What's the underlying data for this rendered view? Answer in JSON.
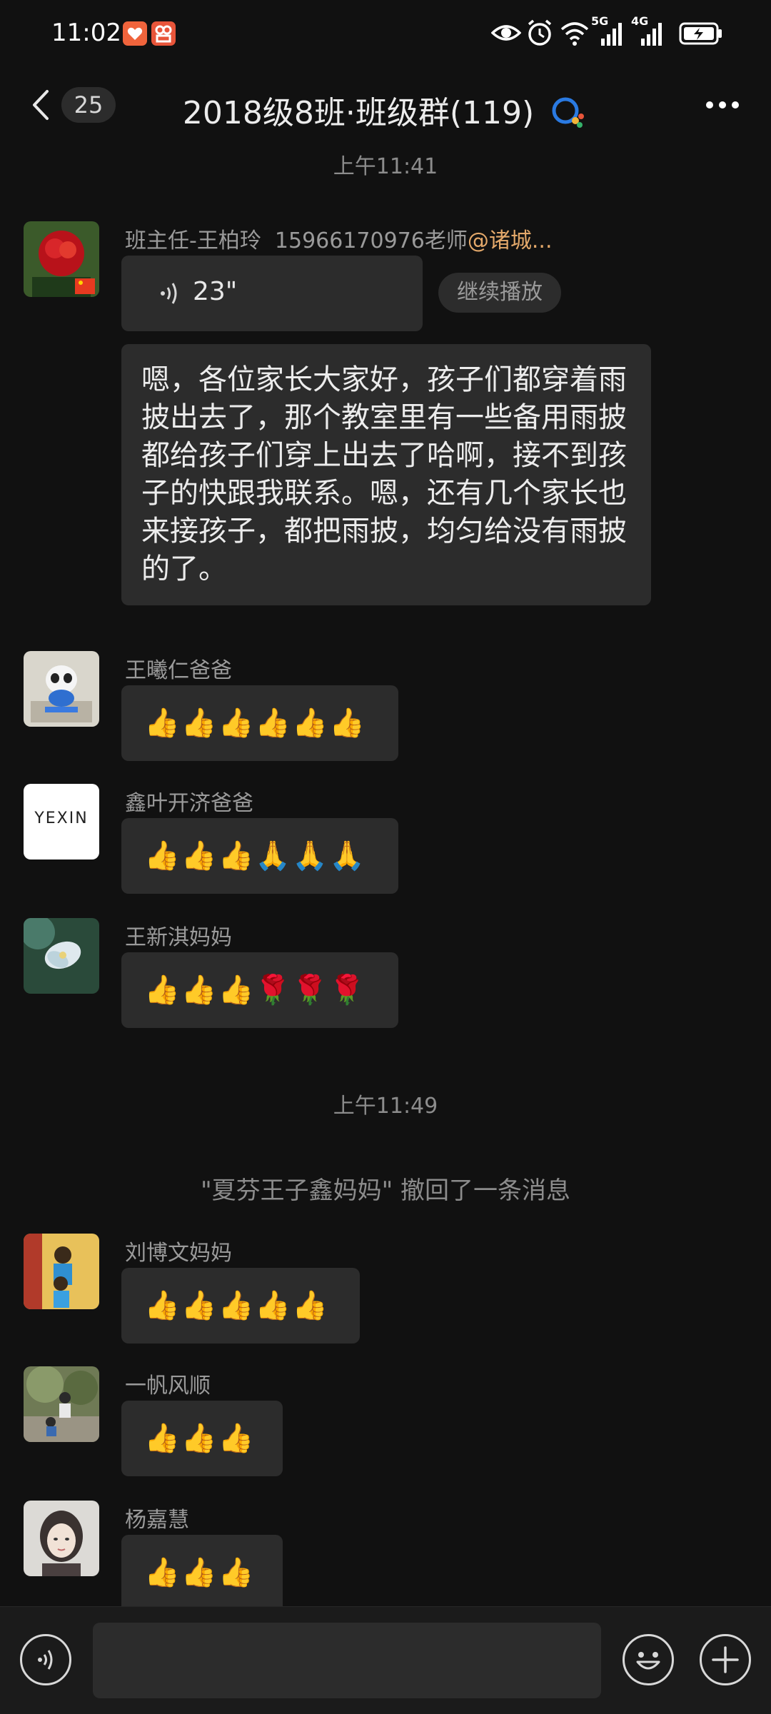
{
  "status_bar": {
    "time": "11:02",
    "network_5g": "5G",
    "network_4g": "4G"
  },
  "header": {
    "unread_count": "25",
    "title": "2018级8班·班级群(119)"
  },
  "messages": [
    {
      "type": "timestamp",
      "text": "上午11:41"
    },
    {
      "type": "voice",
      "sender": "班主任-王柏玲",
      "sender_extra": "15966170976老师",
      "mention": "@诸城...",
      "duration": "23\"",
      "resume_label": "继续播放"
    },
    {
      "type": "text",
      "text": "嗯，各位家长大家好，孩子们都穿着雨披出去了，那个教室里有一些备用雨披都给孩子们穿上出去了哈啊，接不到孩子的快跟我联系。嗯，还有几个家长也来接孩子，都把雨披，均匀给没有雨披的了。"
    },
    {
      "type": "emoji",
      "sender": "王曦仁爸爸",
      "content": "👍👍👍👍👍👍"
    },
    {
      "type": "emoji",
      "sender": "鑫叶开济爸爸",
      "content": "👍👍👍🙏🙏🙏",
      "avatar_text": "YEXIN"
    },
    {
      "type": "emoji",
      "sender": "王新淇妈妈",
      "content": "👍👍👍🌹🌹🌹"
    },
    {
      "type": "timestamp",
      "text": "上午11:49"
    },
    {
      "type": "recall",
      "text": "\"夏芬王子鑫妈妈\" 撤回了一条消息"
    },
    {
      "type": "emoji",
      "sender": "刘博文妈妈",
      "content": "👍👍👍👍👍"
    },
    {
      "type": "emoji",
      "sender": "一帆风顺",
      "content": "👍👍👍"
    },
    {
      "type": "emoji",
      "sender": "杨嘉慧",
      "content": "👍👍👍"
    }
  ],
  "input_bar": {
    "voice_icon": "voice-mode-icon",
    "emoji_icon": "smiley-icon",
    "plus_icon": "plus-icon"
  },
  "colors": {
    "background": "#111111",
    "bubble": "#2c2c2c",
    "mention": "#e3a86a",
    "qq_blue": "#2a7ae2"
  }
}
